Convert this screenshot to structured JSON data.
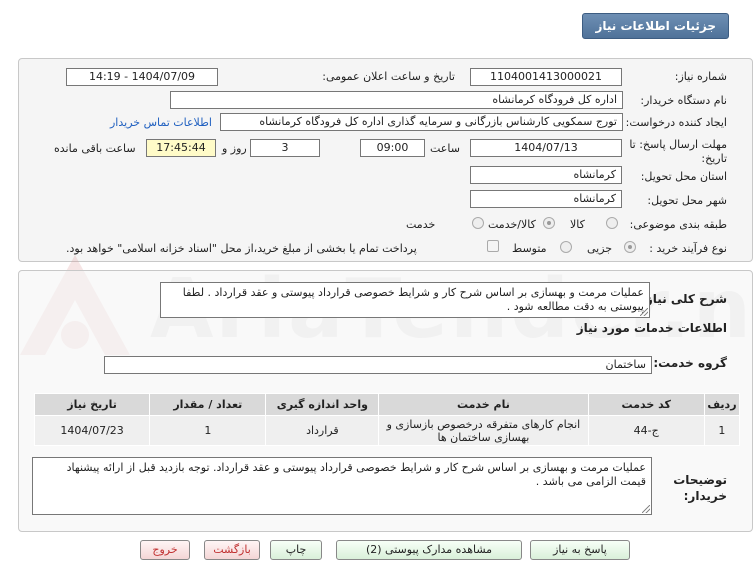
{
  "header": {
    "title": "جزئیات اطلاعات نیاز"
  },
  "form": {
    "need_number_label": "شماره نیاز:",
    "need_number": "1104001413000021",
    "announce_label": "تاریخ و ساعت اعلان عمومی:",
    "announce_value": "1404/07/09 - 14:19",
    "buyer_org_label": "نام دستگاه خریدار:",
    "buyer_org": "اداره کل فرودگاه کرمانشاه",
    "creator_label": "ایجاد کننده درخواست:",
    "creator": "تورج سمکویی کارشناس بازرگانی و سرمایه گذاری اداره کل فرودگاه کرمانشاه",
    "contact_link": "اطلاعات تماس خریدار",
    "deadline_label_1": "مهلت ارسال پاسخ: تا",
    "deadline_label_2": "تاریخ:",
    "deadline_date": "1404/07/13",
    "time_label": "ساعت",
    "deadline_time": "09:00",
    "days_value": "3",
    "days_label": "روز و",
    "remaining_time": "17:45:44",
    "remaining_label": "ساعت باقی مانده",
    "province_label": "استان محل تحویل:",
    "province": "کرمانشاه",
    "city_label": "شهر محل تحویل:",
    "city": "کرمانشاه",
    "category_label": "طبقه بندی موضوعی:",
    "category_options": [
      "کالا",
      "کالا/خدمت",
      "خدمت"
    ],
    "category_selected": "خدمت",
    "process_label": "نوع فرآیند خرید :",
    "process_options": [
      "جزیی",
      "متوسط"
    ],
    "payment_note": "پرداخت تمام یا بخشی از مبلغ خرید،از محل \"اسناد خزانه اسلامی\" خواهد بود."
  },
  "summary": {
    "label": "شرح کلی نیاز:",
    "text": "عملیات مرمت و بهسازی بر اساس شرح کار و شرایط خصوصی قرارداد پیوستی و عقد قرارداد . لطفا پیوستی به دقت مطالعه شود ."
  },
  "services": {
    "title": "اطلاعات خدمات مورد نیاز",
    "group_label": "گروه خدمت:",
    "group_value": "ساختمان",
    "columns": [
      "ردیف",
      "کد خدمت",
      "نام خدمت",
      "واحد اندازه گیری",
      "تعداد / مقدار",
      "تاریخ نیاز"
    ],
    "rows": [
      [
        "1",
        "ج-44",
        "انجام کارهای متفرقه درخصوص بازسازی و بهسازی ساختمان ها",
        "قرارداد",
        "1",
        "1404/07/23"
      ]
    ]
  },
  "buyer_notes": {
    "label_1": "توضیحات",
    "label_2": "خریدار:",
    "text": "عملیات مرمت و بهسازی بر اساس شرح کار و شرایط خصوصی قرارداد پیوستی و عقد قرارداد. توجه بازدید قبل از ارائه پیشنهاد قیمت الزامی می باشد ."
  },
  "buttons": {
    "reply": "پاسخ به نیاز",
    "attachments": "مشاهده مدارک پیوستی (2)",
    "print": "چاپ",
    "back": "بازگشت",
    "exit": "خروج"
  },
  "watermark": {
    "text": "AriaTender.net"
  },
  "colors": {
    "header_bg": "#4f7299",
    "link": "#2060c0",
    "highlight": "#fffbc8",
    "button_green": "#d9f0d9",
    "button_red": "#f4d6d6"
  }
}
